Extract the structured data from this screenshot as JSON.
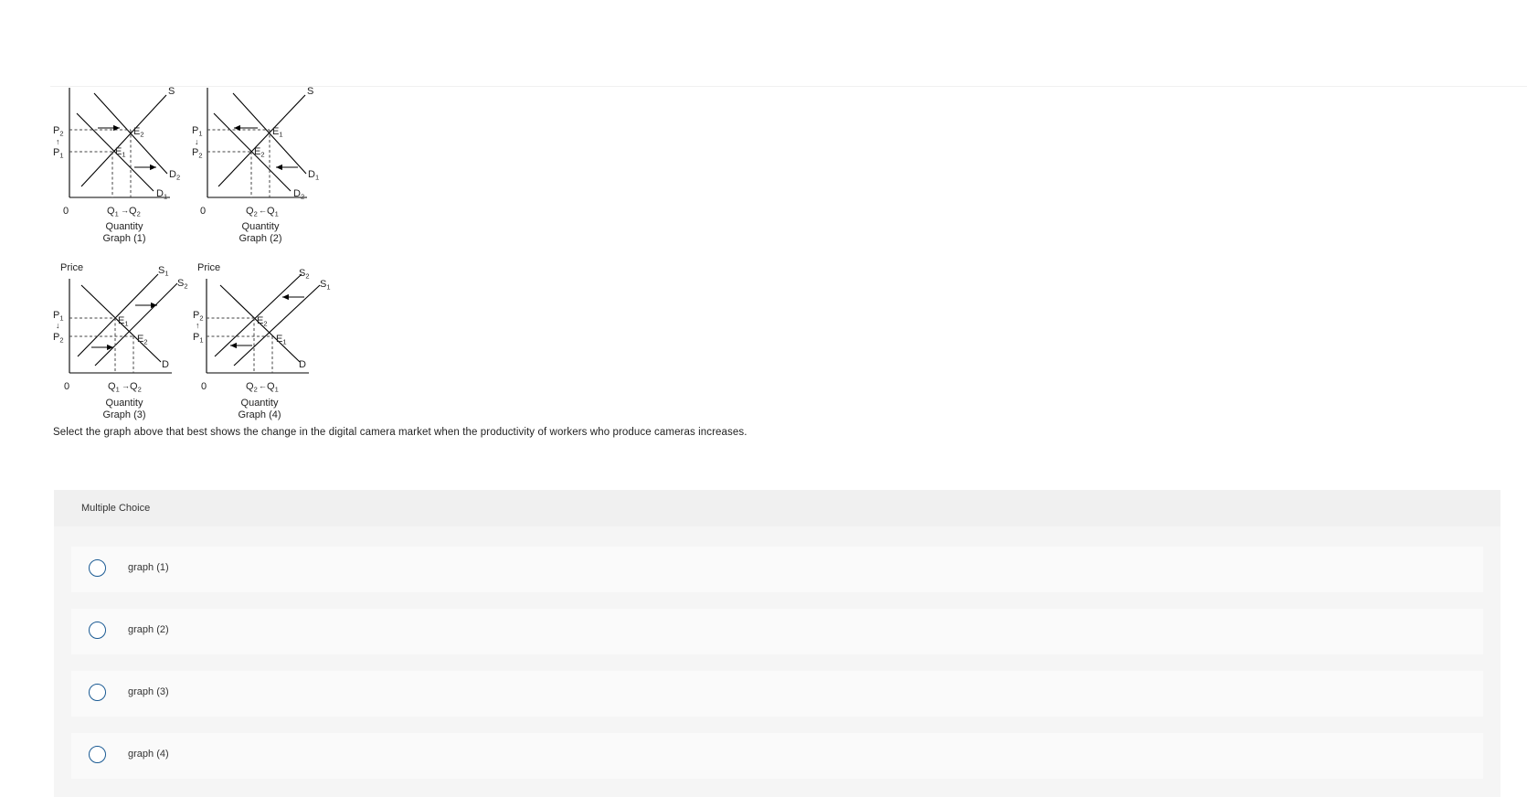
{
  "graphs": [
    {
      "id": "graph1",
      "price_label": "",
      "price_high": [
        "P",
        "2"
      ],
      "price_low": [
        "P",
        "1"
      ],
      "qty_left": [
        "Q",
        "1"
      ],
      "qty_right": [
        "Q",
        "2"
      ],
      "origin": "0",
      "eq_upper": [
        "E",
        "2"
      ],
      "eq_lower": [
        "E",
        "1"
      ],
      "supply_labels": [
        [
          "S",
          ""
        ]
      ],
      "demand_labels": [
        [
          "D",
          "2"
        ],
        [
          "D",
          "1"
        ]
      ],
      "axis_label": "Quantity",
      "caption": "Graph (1)"
    },
    {
      "id": "graph2",
      "price_label": "",
      "price_high": [
        "P",
        "1"
      ],
      "price_low": [
        "P",
        "2"
      ],
      "qty_left": [
        "Q",
        "2"
      ],
      "qty_right": [
        "Q",
        "1"
      ],
      "origin": "0",
      "eq_upper": [
        "E",
        "1"
      ],
      "eq_lower": [
        "E",
        "2"
      ],
      "supply_labels": [
        [
          "S",
          ""
        ]
      ],
      "demand_labels": [
        [
          "D",
          "1"
        ],
        [
          "D",
          "2"
        ]
      ],
      "axis_label": "Quantity",
      "caption": "Graph (2)"
    },
    {
      "id": "graph3",
      "price_label": "Price",
      "price_high": [
        "P",
        "1"
      ],
      "price_low": [
        "P",
        "2"
      ],
      "qty_left": [
        "Q",
        "1"
      ],
      "qty_right": [
        "Q",
        "2"
      ],
      "origin": "0",
      "eq_upper": [
        "E",
        "1"
      ],
      "eq_lower": [
        "E",
        "2"
      ],
      "supply_labels": [
        [
          "S",
          "1"
        ],
        [
          "S",
          "2"
        ]
      ],
      "demand_labels": [
        [
          "D",
          ""
        ]
      ],
      "axis_label": "Quantity",
      "caption": "Graph (3)"
    },
    {
      "id": "graph4",
      "price_label": "Price",
      "price_high": [
        "P",
        "2"
      ],
      "price_low": [
        "P",
        "1"
      ],
      "qty_left": [
        "Q",
        "2"
      ],
      "qty_right": [
        "Q",
        "1"
      ],
      "origin": "0",
      "eq_upper": [
        "E",
        "2"
      ],
      "eq_lower": [
        "E",
        "1"
      ],
      "supply_labels": [
        [
          "S",
          "2"
        ],
        [
          "S",
          "1"
        ]
      ],
      "demand_labels": [
        [
          "D",
          ""
        ]
      ],
      "axis_label": "Quantity",
      "caption": "Graph (4)"
    }
  ],
  "question": "Select the graph above that best shows the change in the digital camera market when the productivity of workers who produce cameras increases.",
  "multiple_choice": {
    "title": "Multiple Choice",
    "options": [
      {
        "label": "graph (1)"
      },
      {
        "label": "graph (2)"
      },
      {
        "label": "graph (3)"
      },
      {
        "label": "graph (4)"
      }
    ]
  },
  "colors": {
    "radio_border": "#1a5a93",
    "panel_bg": "#f5f5f5",
    "option_bg": "#fafafa"
  }
}
